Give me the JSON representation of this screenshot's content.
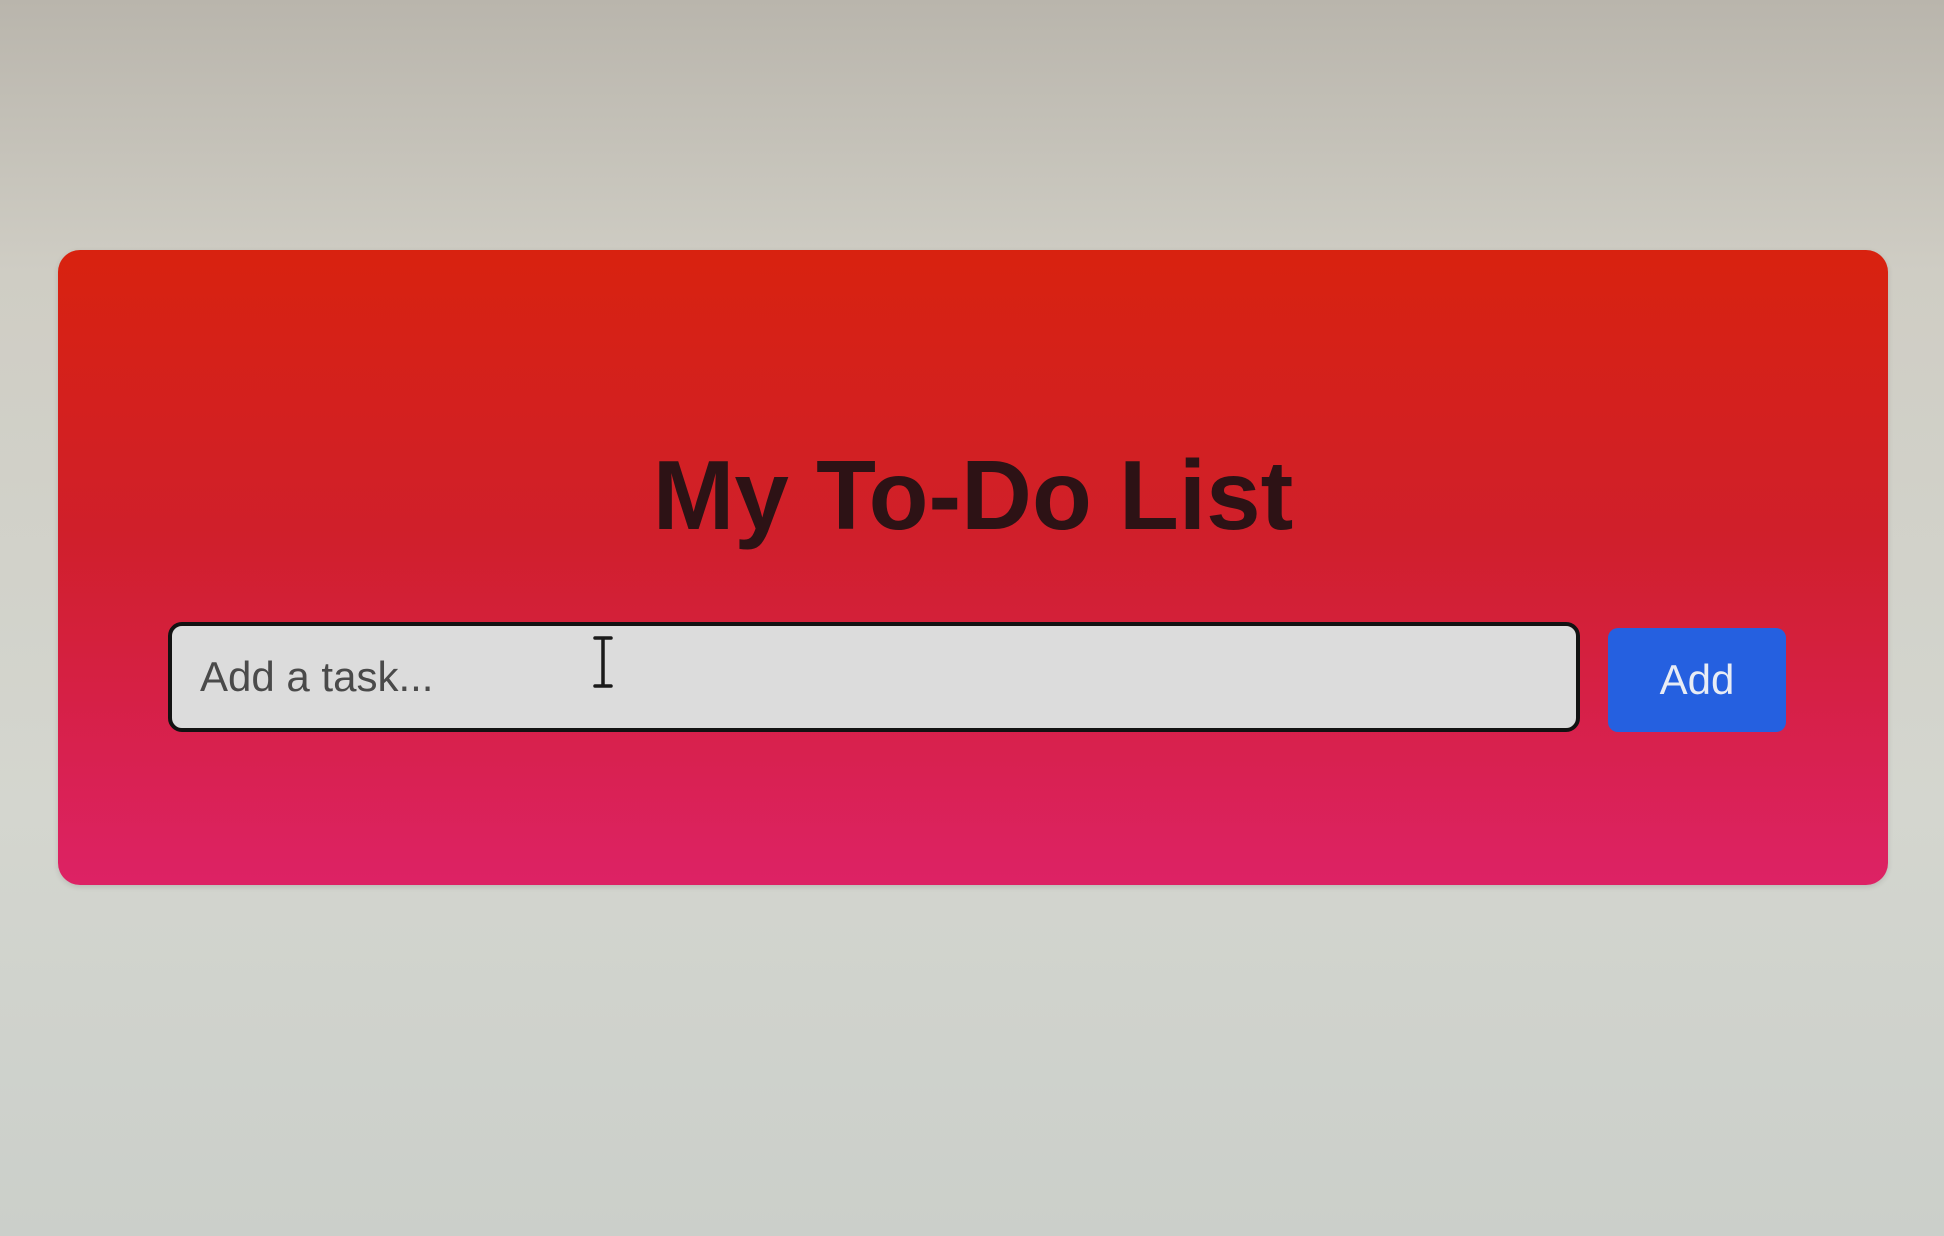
{
  "app": {
    "title": "My To-Do List"
  },
  "task_form": {
    "input_value": "",
    "input_placeholder": "Add a task...",
    "add_label": "Add"
  },
  "icons": {
    "cursor": "text-cursor-icon"
  },
  "colors": {
    "card_top": "#d8220f",
    "card_bottom": "#dd2265",
    "title_text": "#2d1215",
    "input_background": "#dcdcdc",
    "add_button": "#2560e0",
    "add_button_text": "#e8ecf5"
  }
}
